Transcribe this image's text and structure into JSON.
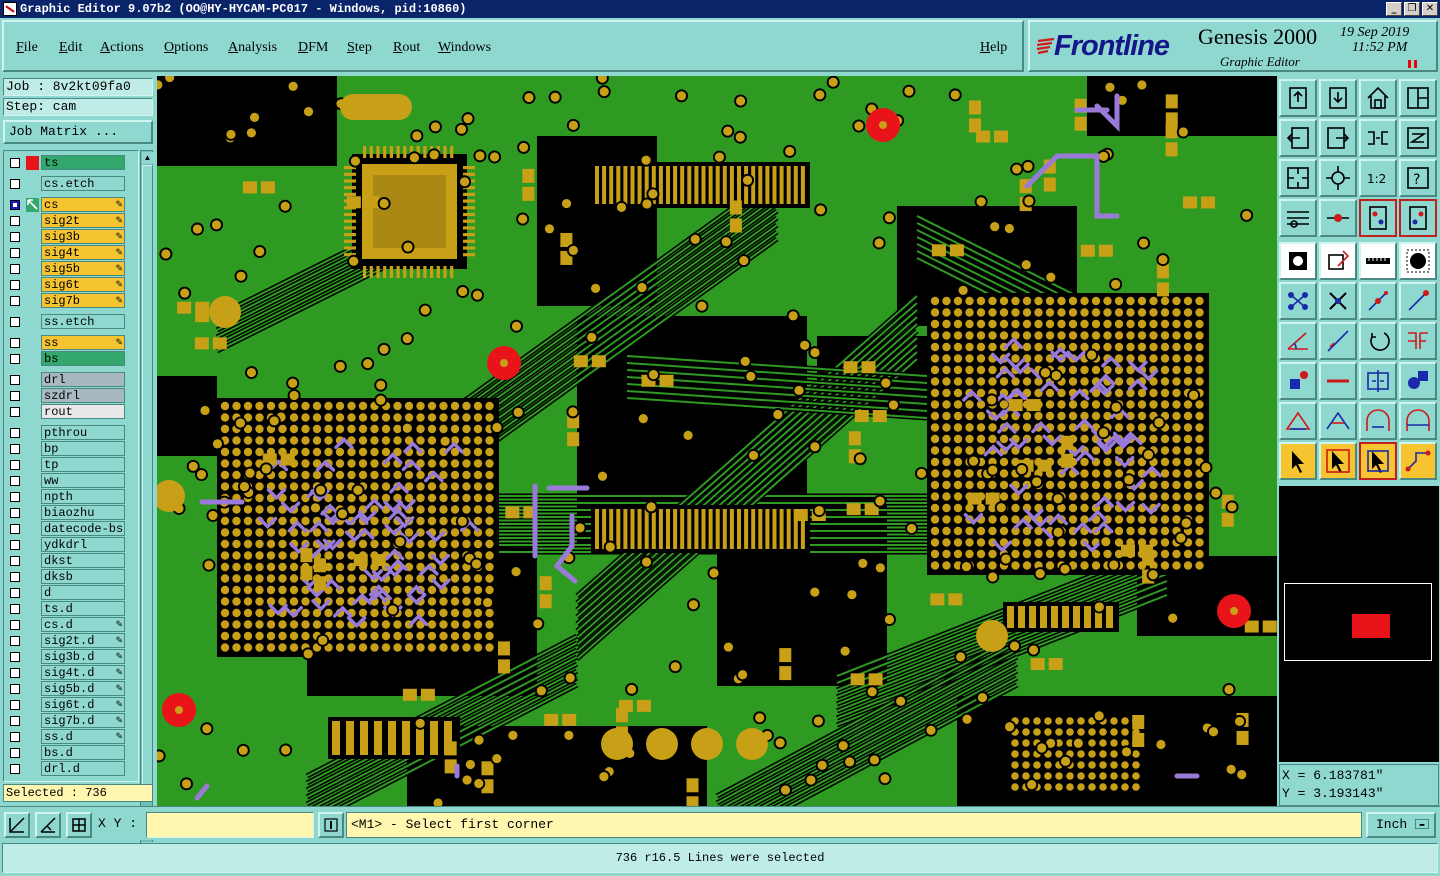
{
  "window": {
    "title": "Graphic Editor 9.07b2 (OO@HY-HYCAM-PC017 - Windows, pid:10860)",
    "controls": [
      "_",
      "❐",
      "✕"
    ]
  },
  "menu": {
    "items": [
      {
        "id": "file",
        "label": "File"
      },
      {
        "id": "edit",
        "label": "Edit"
      },
      {
        "id": "actions",
        "label": "Actions"
      },
      {
        "id": "options",
        "label": "Options"
      },
      {
        "id": "analysis",
        "label": "Analysis"
      },
      {
        "id": "dfm",
        "label": "DFM"
      },
      {
        "id": "step",
        "label": "Step"
      },
      {
        "id": "rout",
        "label": "Rout"
      },
      {
        "id": "windows",
        "label": "Windows"
      }
    ],
    "help": "Help"
  },
  "brand": {
    "name": "Frontline",
    "product": "Genesis 2000",
    "subtitle": "Graphic Editor",
    "date": "19 Sep 2019",
    "time": "11:52 PM",
    "accent": "#14168a"
  },
  "job": {
    "job_label": "Job : 8v2kt09fa0",
    "step_label": "Step: cam",
    "matrix_button": "Job Matrix ..."
  },
  "layers": [
    {
      "name": "ts",
      "color": "#34a86c",
      "checked": false,
      "mark": "red",
      "editable": false
    },
    {
      "name": "cs.etch",
      "color": "#8fd8d0",
      "checked": false,
      "mark": "",
      "editable": false
    },
    {
      "name": "cs",
      "color": "#f6c431",
      "checked": true,
      "mark": "arrow",
      "editable": true
    },
    {
      "name": "sig2t",
      "color": "#f6c431",
      "checked": false,
      "mark": "",
      "editable": true
    },
    {
      "name": "sig3b",
      "color": "#f6c431",
      "checked": false,
      "mark": "",
      "editable": true
    },
    {
      "name": "sig4t",
      "color": "#f6c431",
      "checked": false,
      "mark": "",
      "editable": true
    },
    {
      "name": "sig5b",
      "color": "#f6c431",
      "checked": false,
      "mark": "",
      "editable": true
    },
    {
      "name": "sig6t",
      "color": "#f6c431",
      "checked": false,
      "mark": "",
      "editable": true
    },
    {
      "name": "sig7b",
      "color": "#f6c431",
      "checked": false,
      "mark": "",
      "editable": true
    },
    {
      "name": "ss.etch",
      "color": "#8fd8d0",
      "checked": false,
      "mark": "",
      "editable": false
    },
    {
      "name": "ss",
      "color": "#f6c431",
      "checked": false,
      "mark": "",
      "editable": true
    },
    {
      "name": "bs",
      "color": "#34a86c",
      "checked": false,
      "mark": "",
      "editable": false
    },
    {
      "name": "drl",
      "color": "#a8b8c0",
      "checked": false,
      "mark": "",
      "editable": false
    },
    {
      "name": "szdrl",
      "color": "#a8b8c0",
      "checked": false,
      "mark": "",
      "editable": false
    },
    {
      "name": "rout",
      "color": "#e8e8e8",
      "checked": false,
      "mark": "",
      "editable": false
    },
    {
      "name": "pthrou",
      "color": "#8fd8d0",
      "checked": false,
      "mark": "",
      "editable": false
    },
    {
      "name": "bp",
      "color": "#8fd8d0",
      "checked": false,
      "mark": "",
      "editable": false
    },
    {
      "name": "tp",
      "color": "#8fd8d0",
      "checked": false,
      "mark": "",
      "editable": false
    },
    {
      "name": "ww",
      "color": "#8fd8d0",
      "checked": false,
      "mark": "",
      "editable": false
    },
    {
      "name": "npth",
      "color": "#8fd8d0",
      "checked": false,
      "mark": "",
      "editable": false
    },
    {
      "name": "biaozhu",
      "color": "#8fd8d0",
      "checked": false,
      "mark": "",
      "editable": false
    },
    {
      "name": "datecode-bs",
      "color": "#8fd8d0",
      "checked": false,
      "mark": "",
      "editable": false
    },
    {
      "name": "ydkdrl",
      "color": "#8fd8d0",
      "checked": false,
      "mark": "",
      "editable": false
    },
    {
      "name": "dkst",
      "color": "#8fd8d0",
      "checked": false,
      "mark": "",
      "editable": false
    },
    {
      "name": "dksb",
      "color": "#8fd8d0",
      "checked": false,
      "mark": "",
      "editable": false
    },
    {
      "name": "d",
      "color": "#8fd8d0",
      "checked": false,
      "mark": "",
      "editable": false
    },
    {
      "name": "ts.d",
      "color": "#8fd8d0",
      "checked": false,
      "mark": "",
      "editable": false
    },
    {
      "name": "cs.d",
      "color": "#8fd8d0",
      "checked": false,
      "mark": "",
      "editable": true
    },
    {
      "name": "sig2t.d",
      "color": "#8fd8d0",
      "checked": false,
      "mark": "",
      "editable": true
    },
    {
      "name": "sig3b.d",
      "color": "#8fd8d0",
      "checked": false,
      "mark": "",
      "editable": true
    },
    {
      "name": "sig4t.d",
      "color": "#8fd8d0",
      "checked": false,
      "mark": "",
      "editable": true
    },
    {
      "name": "sig5b.d",
      "color": "#8fd8d0",
      "checked": false,
      "mark": "",
      "editable": true
    },
    {
      "name": "sig6t.d",
      "color": "#8fd8d0",
      "checked": false,
      "mark": "",
      "editable": true
    },
    {
      "name": "sig7b.d",
      "color": "#8fd8d0",
      "checked": false,
      "mark": "",
      "editable": true
    },
    {
      "name": "ss.d",
      "color": "#8fd8d0",
      "checked": false,
      "mark": "",
      "editable": true
    },
    {
      "name": "bs.d",
      "color": "#8fd8d0",
      "checked": false,
      "mark": "",
      "editable": false
    },
    {
      "name": "drl.d",
      "color": "#8fd8d0",
      "checked": false,
      "mark": "",
      "editable": false
    }
  ],
  "selection": {
    "label": "Selected : 736"
  },
  "canvas": {
    "colors": {
      "background": "#000000",
      "copper": "#c8a018",
      "mask": "#2f9a22",
      "trace": "#2f9a22",
      "selected": "#9a7ad8",
      "fiducial": "#e8141a"
    }
  },
  "toolbar": {
    "tools": [
      "page-up-icon",
      "page-down-icon",
      "home-icon",
      "pan-icon",
      "pan-left-icon",
      "pan-right-icon",
      "zoom-back-icon",
      "redraw-icon",
      "fit-icon",
      "center-icon",
      "one-to-one-icon",
      "query-icon",
      "snap-icon",
      "measure-icon",
      "layer-up-icon",
      "layer-down-icon",
      "display-icon",
      "outline-icon",
      "ruler-icon",
      "fill-icon",
      "net-icon",
      "cross-icon",
      "node-icon",
      "end-icon",
      "angle-icon",
      "line-icon",
      "arc-icon",
      "split-icon",
      "pad-icon",
      "minus-icon",
      "mirror-icon",
      "shape-icon",
      "triangle-icon",
      "triangle-a-icon",
      "arch-icon",
      "wave-icon",
      "pointer-icon",
      "select-icon",
      "select-rect-icon",
      "route-icon"
    ]
  },
  "coordinates": {
    "x": "X = 6.183781\"",
    "y": "Y = 3.193143\""
  },
  "command": {
    "xy_label": "X Y :",
    "xy_value": "",
    "prompt": "<M1> - Select first corner",
    "units": "Inch",
    "units_arrow": "▬"
  },
  "status": {
    "message": "736 r16.5 Lines were selected"
  }
}
